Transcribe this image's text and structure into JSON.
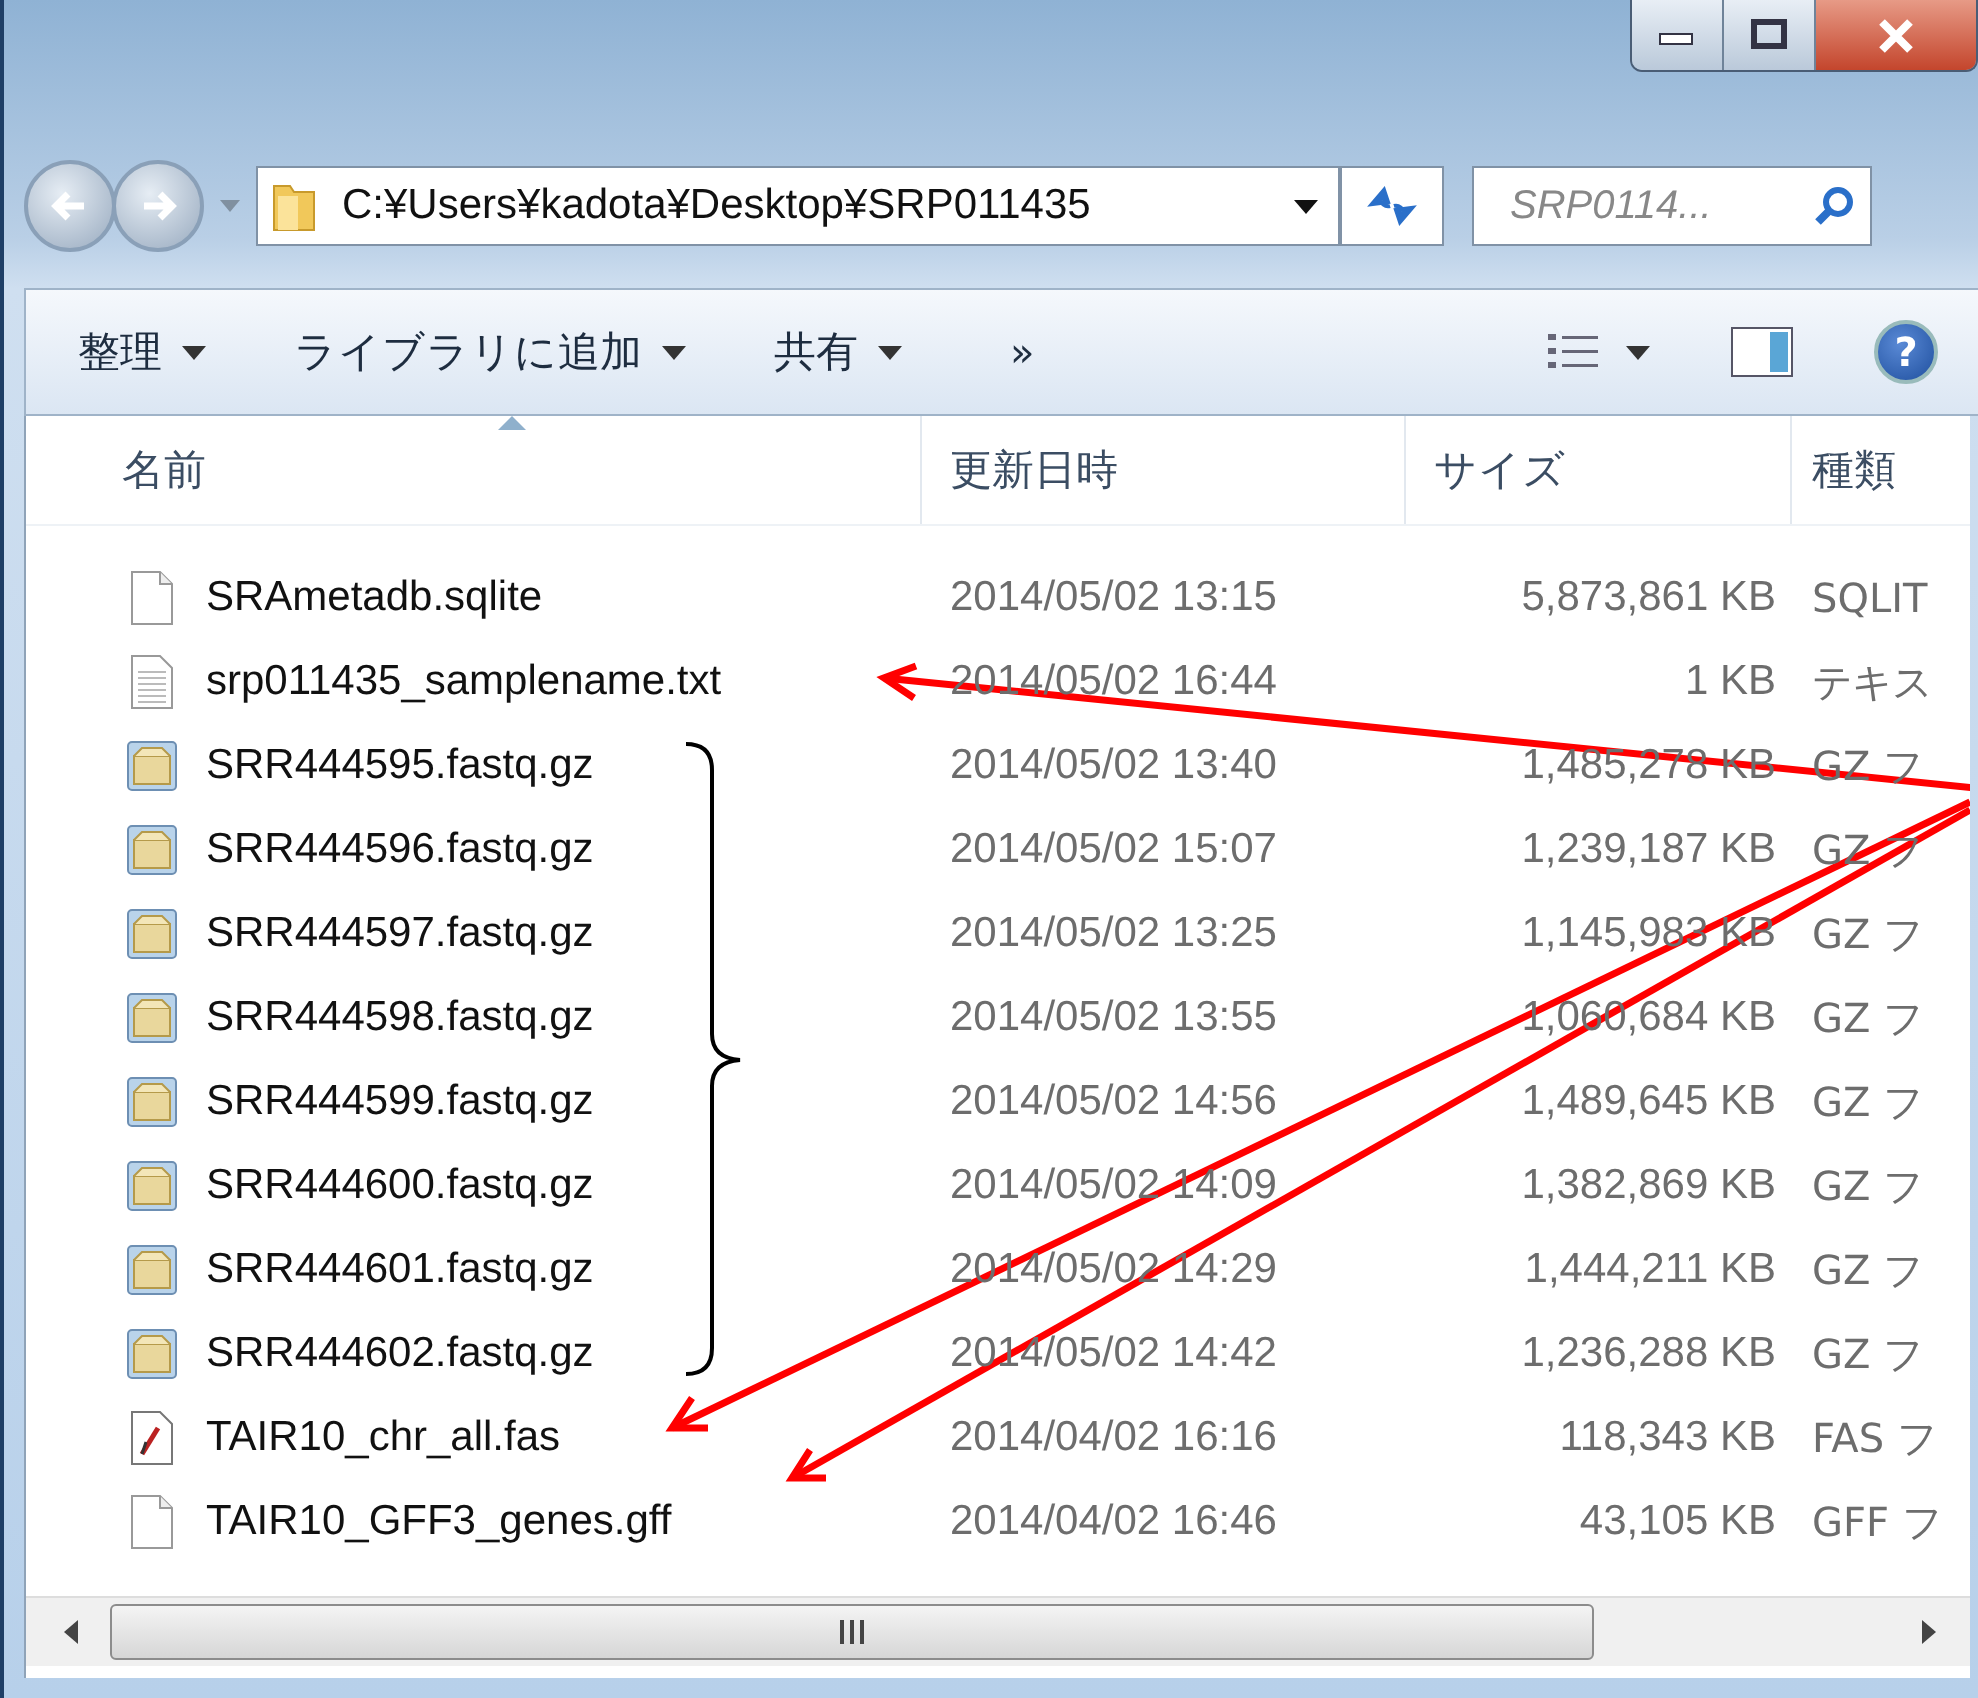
{
  "address_bar": {
    "path": "C:¥Users¥kadota¥Desktop¥SRP011435"
  },
  "search": {
    "placeholder": "SRP0114..."
  },
  "help_button": {
    "label": "?"
  },
  "toolbar": {
    "items": [
      {
        "label": "整理",
        "kind": "menu"
      },
      {
        "label": "ライブラリに追加",
        "kind": "menu"
      },
      {
        "label": "共有",
        "kind": "menu"
      },
      {
        "label": "»",
        "kind": "more"
      }
    ]
  },
  "columns": [
    {
      "label": "名前",
      "sorted": true
    },
    {
      "label": "更新日時",
      "sorted": false
    },
    {
      "label": "サイズ",
      "sorted": false
    },
    {
      "label": "種類",
      "sorted": false
    }
  ],
  "files": [
    {
      "name": "SRAmetadb.sqlite",
      "kind": "blank",
      "modified": "2014/05/02 13:15",
      "size": "5,873,861 KB",
      "type": "SQLIT"
    },
    {
      "name": "srp011435_samplename.txt",
      "kind": "text",
      "modified": "2014/05/02 16:44",
      "size": "1 KB",
      "type": "テキス"
    },
    {
      "name": "SRR444595.fastq.gz",
      "kind": "archive",
      "modified": "2014/05/02 13:40",
      "size": "1,485,278 KB",
      "type": "GZ フ"
    },
    {
      "name": "SRR444596.fastq.gz",
      "kind": "archive",
      "modified": "2014/05/02 15:07",
      "size": "1,239,187 KB",
      "type": "GZ フ"
    },
    {
      "name": "SRR444597.fastq.gz",
      "kind": "archive",
      "modified": "2014/05/02 13:25",
      "size": "1,145,983 KB",
      "type": "GZ フ"
    },
    {
      "name": "SRR444598.fastq.gz",
      "kind": "archive",
      "modified": "2014/05/02 13:55",
      "size": "1,060,684 KB",
      "type": "GZ フ"
    },
    {
      "name": "SRR444599.fastq.gz",
      "kind": "archive",
      "modified": "2014/05/02 14:56",
      "size": "1,489,645 KB",
      "type": "GZ フ"
    },
    {
      "name": "SRR444600.fastq.gz",
      "kind": "archive",
      "modified": "2014/05/02 14:09",
      "size": "1,382,869 KB",
      "type": "GZ フ"
    },
    {
      "name": "SRR444601.fastq.gz",
      "kind": "archive",
      "modified": "2014/05/02 14:29",
      "size": "1,444,211 KB",
      "type": "GZ フ"
    },
    {
      "name": "SRR444602.fastq.gz",
      "kind": "archive",
      "modified": "2014/05/02 14:42",
      "size": "1,236,288 KB",
      "type": "GZ フ"
    },
    {
      "name": "TAIR10_chr_all.fas",
      "kind": "fas",
      "modified": "2014/04/02 16:16",
      "size": "118,343 KB",
      "type": "FAS フ"
    },
    {
      "name": "TAIR10_GFF3_genes.gff",
      "kind": "blank",
      "modified": "2014/04/02 16:46",
      "size": "43,105 KB",
      "type": "GFF フ"
    }
  ]
}
